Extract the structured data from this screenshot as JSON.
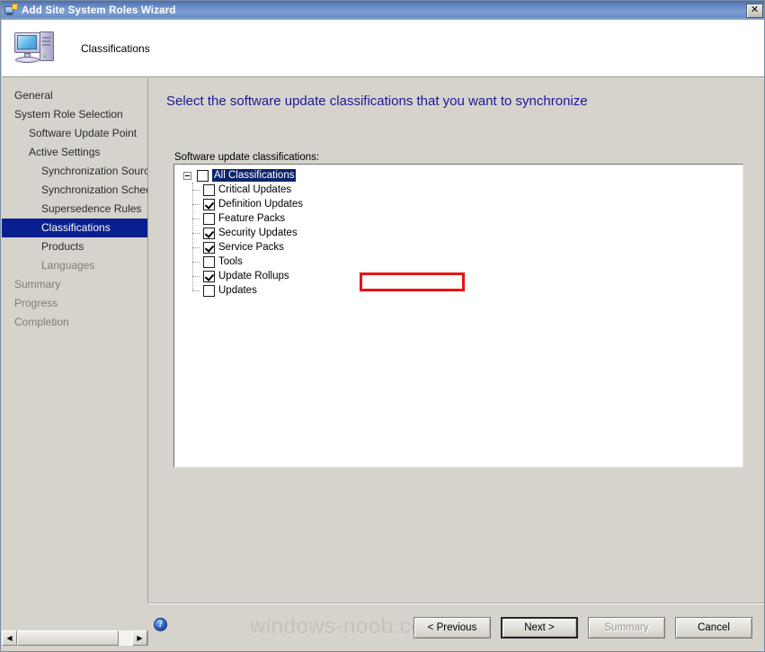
{
  "window": {
    "title": "Add Site System Roles Wizard",
    "title_icon": "wizard-computer-icon",
    "close_label": "✕"
  },
  "header": {
    "icon": "computer-monitor-icon",
    "title": "Classifications"
  },
  "sidebar": {
    "items": [
      {
        "label": "General",
        "level": 0,
        "state": "normal"
      },
      {
        "label": "System Role Selection",
        "level": 0,
        "state": "normal"
      },
      {
        "label": "Software Update Point",
        "level": 1,
        "state": "normal"
      },
      {
        "label": "Active Settings",
        "level": 1,
        "state": "normal"
      },
      {
        "label": "Synchronization Source",
        "level": 2,
        "state": "normal"
      },
      {
        "label": "Synchronization Schedule",
        "level": 2,
        "state": "normal"
      },
      {
        "label": "Supersedence Rules",
        "level": 2,
        "state": "normal"
      },
      {
        "label": "Classifications",
        "level": 2,
        "state": "selected"
      },
      {
        "label": "Products",
        "level": 2,
        "state": "normal"
      },
      {
        "label": "Languages",
        "level": 2,
        "state": "dim"
      },
      {
        "label": "Summary",
        "level": 0,
        "state": "dim"
      },
      {
        "label": "Progress",
        "level": 0,
        "state": "dim"
      },
      {
        "label": "Completion",
        "level": 0,
        "state": "dim"
      }
    ],
    "scrollbar": {
      "left_arrow": "◀",
      "right_arrow": "▶"
    }
  },
  "content": {
    "heading": "Select the software update classifications that you want to synchronize",
    "field_label": "Software update classifications:",
    "tree": {
      "root": {
        "label": "All Classifications",
        "checked": false,
        "selected": true,
        "expanded": true
      },
      "children": [
        {
          "label": "Critical Updates",
          "checked": false
        },
        {
          "label": "Definition Updates",
          "checked": true
        },
        {
          "label": "Feature Packs",
          "checked": false
        },
        {
          "label": "Security Updates",
          "checked": true
        },
        {
          "label": "Service Packs",
          "checked": true
        },
        {
          "label": "Tools",
          "checked": false
        },
        {
          "label": "Update Rollups",
          "checked": true
        },
        {
          "label": "Updates",
          "checked": false
        }
      ]
    },
    "annotation": {
      "type": "red-highlight-rectangle",
      "target": "Definition Updates",
      "color": "#e81313"
    }
  },
  "footer": {
    "help_icon": "?",
    "watermark": "windows-noob.com",
    "buttons": [
      {
        "label": "< Previous",
        "state": "normal"
      },
      {
        "label": "Next >",
        "state": "default"
      },
      {
        "label": "Summary",
        "state": "disabled"
      },
      {
        "label": "Cancel",
        "state": "normal"
      }
    ]
  }
}
